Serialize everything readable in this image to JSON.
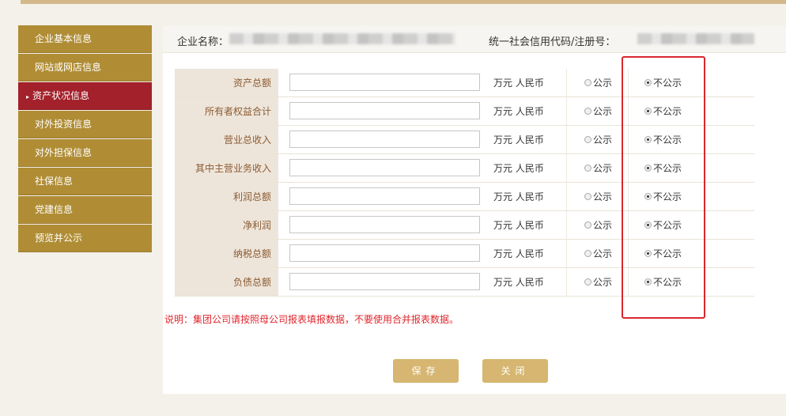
{
  "sidebar": {
    "items": [
      {
        "label": "企业基本信息"
      },
      {
        "label": "网站或网店信息"
      },
      {
        "label": "资产状况信息",
        "arrow": "▸"
      },
      {
        "label": "对外投资信息"
      },
      {
        "label": "对外担保信息"
      },
      {
        "label": "社保信息"
      },
      {
        "label": "党建信息"
      },
      {
        "label": "预览并公示"
      }
    ]
  },
  "header": {
    "company_label": "企业名称：",
    "credit_label": "统一社会信用代码/注册号："
  },
  "form": {
    "unit": "万元 人民币",
    "public_label": "公示",
    "nonpublic_label": "不公示",
    "rows": [
      {
        "label": "资产总额",
        "value": "",
        "selected": "不公示"
      },
      {
        "label": "所有者权益合计",
        "value": "",
        "selected": "不公示"
      },
      {
        "label": "营业总收入",
        "value": "",
        "selected": "不公示"
      },
      {
        "label": "其中主营业务收入",
        "value": "",
        "selected": "不公示"
      },
      {
        "label": "利润总额",
        "value": "",
        "selected": "不公示"
      },
      {
        "label": "净利润",
        "value": "",
        "selected": "不公示"
      },
      {
        "label": "纳税总额",
        "value": "",
        "selected": "不公示"
      },
      {
        "label": "负债总额",
        "value": "",
        "selected": "不公示"
      }
    ]
  },
  "note": "说明：集团公司请按照母公司报表填报数据，不要使用合并报表数据。",
  "buttons": {
    "save": "保存",
    "close": "关闭"
  },
  "colors": {
    "sidebar": "#b08d35",
    "sidebar_active": "#a3212a",
    "button": "#d6b670",
    "highlight": "#d9272e"
  }
}
